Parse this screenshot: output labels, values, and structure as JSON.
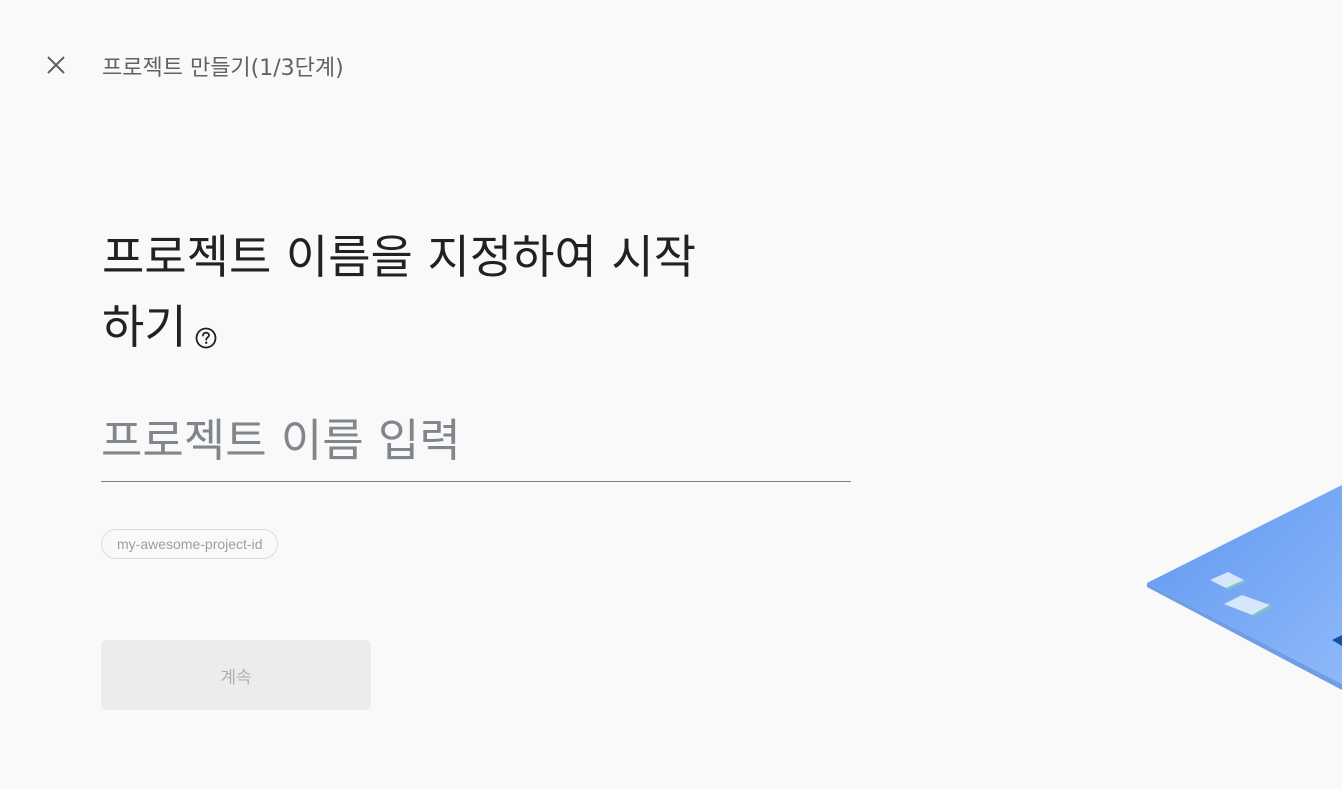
{
  "header": {
    "close_icon": "close-icon",
    "step_title": "프로젝트 만들기(1/3단계)"
  },
  "main": {
    "headline": "프로젝트 이름을 지정하여 시작하기",
    "help_icon": "help-circle-icon",
    "name_input": {
      "value": "",
      "placeholder": "프로젝트 이름 입력"
    },
    "project_id_chip": "my-awesome-project-id",
    "continue_label": "계속"
  },
  "colors": {
    "background": "#f9f9f9",
    "headline": "#202124",
    "secondary_text": "#5f6368",
    "button_disabled_bg": "#ececec",
    "button_disabled_text": "#b0b0b0",
    "illustration_blue": "#8ab4f8"
  }
}
